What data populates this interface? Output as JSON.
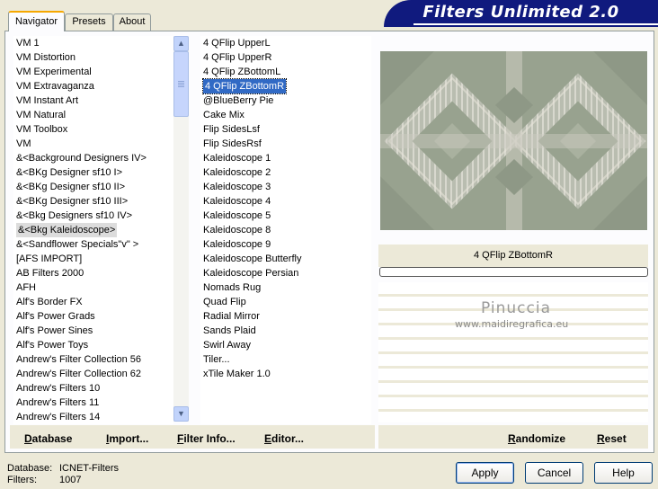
{
  "tabs": [
    {
      "label": "Navigator",
      "active": true
    },
    {
      "label": "Presets",
      "active": false
    },
    {
      "label": "About",
      "active": false
    }
  ],
  "banner": "Filters Unlimited 2.0",
  "categories": {
    "items": [
      "VM 1",
      "VM Distortion",
      "VM Experimental",
      "VM Extravaganza",
      "VM Instant Art",
      "VM Natural",
      "VM Toolbox",
      "VM",
      "&<Background Designers IV>",
      "&<BKg Designer sf10 I>",
      "&<BKg Designer sf10 II>",
      "&<BKg Designer sf10 III>",
      "&<Bkg Designers sf10 IV>",
      "&<Bkg Kaleidoscope>",
      "&<Sandflower Specials\"v\" >",
      "[AFS IMPORT]",
      "AB Filters 2000",
      "AFH",
      "Alf's Border FX",
      "Alf's Power Grads",
      "Alf's Power Sines",
      "Alf's Power Toys",
      "Andrew's Filter Collection 56",
      "Andrew's Filter Collection 62",
      "Andrew's Filters 10",
      "Andrew's Filters 11",
      "Andrew's Filters 14"
    ],
    "selected": "&<Bkg Kaleidoscope>"
  },
  "filters": {
    "items": [
      "4 QFlip UpperL",
      "4 QFlip UpperR",
      "4 QFlip ZBottomL",
      "4 QFlip ZBottomR",
      "@BlueBerry Pie",
      "Cake Mix",
      "Flip SidesLsf",
      "Flip SidesRsf",
      "Kaleidoscope 1",
      "Kaleidoscope 2",
      "Kaleidoscope 3",
      "Kaleidoscope 4",
      "Kaleidoscope 5",
      "Kaleidoscope 8",
      "Kaleidoscope 9",
      "Kaleidoscope Butterfly",
      "Kaleidoscope Persian",
      "Nomads Rug",
      "Quad Flip",
      "Radial Mirror",
      "Sands Plaid",
      "Swirl Away",
      "Tiler...",
      "xTile Maker 1.0"
    ],
    "selected": "4 QFlip ZBottomR"
  },
  "preview": {
    "filter_name": "4 QFlip ZBottomR"
  },
  "watermark": {
    "line1": "Pinuccia",
    "line2": "www.maidiregrafica.eu"
  },
  "bottom_buttons": {
    "database": "Database",
    "import": "Import...",
    "filter_info": "Filter Info...",
    "editor": "Editor...",
    "randomize": "Randomize",
    "reset": "Reset"
  },
  "status": {
    "database_label": "Database:",
    "database_value": "ICNET-Filters",
    "filters_label": "Filters:",
    "filters_value": "1007"
  },
  "dialog_buttons": {
    "apply": "Apply",
    "cancel": "Cancel",
    "help": "Help"
  }
}
